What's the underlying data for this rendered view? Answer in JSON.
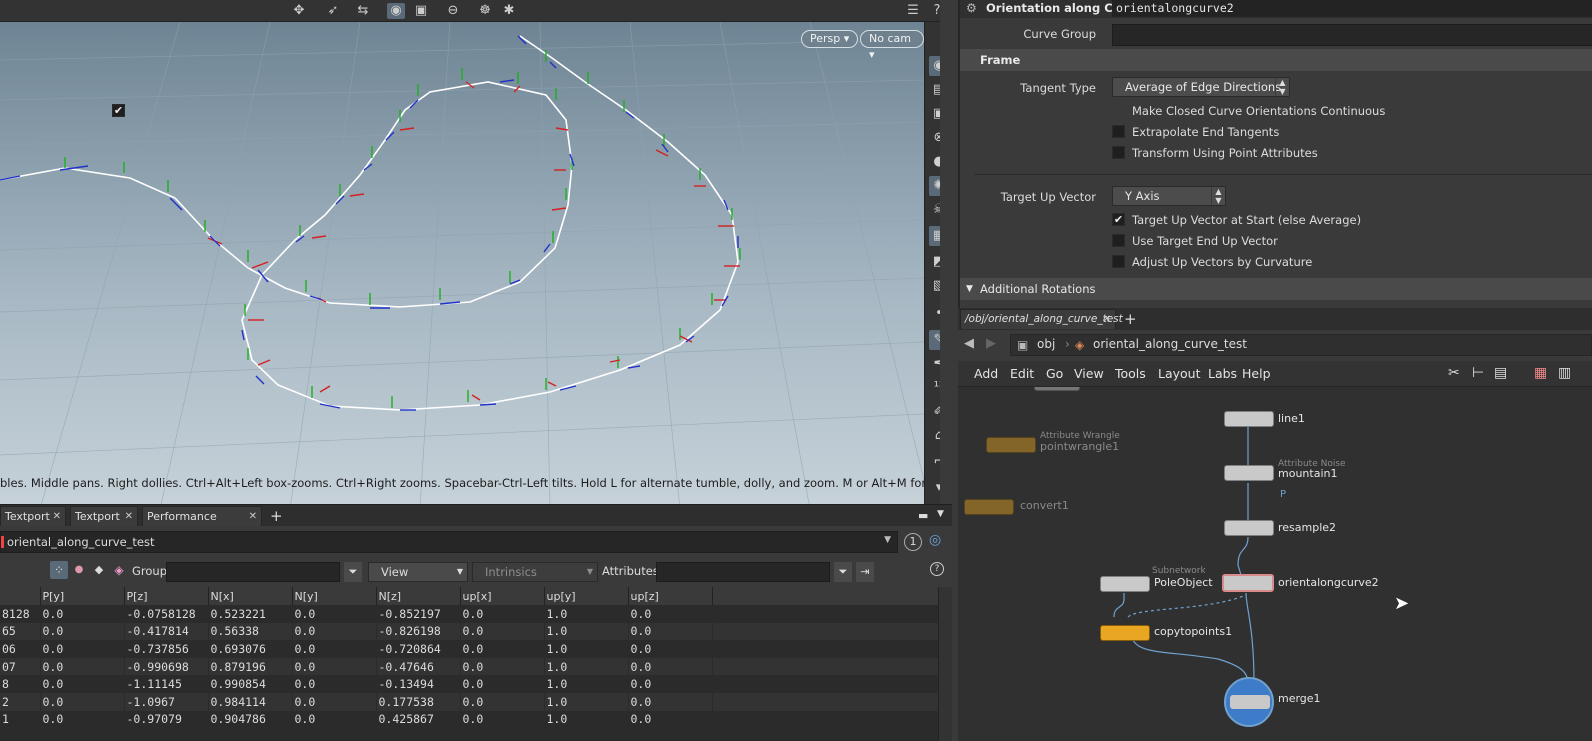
{
  "viewport": {
    "persp_label": "Persp ▾",
    "cam_label": "No cam ▾",
    "status_text": "bles. Middle pans. Right dollies. Ctrl+Alt+Left box-zooms. Ctrl+Right zooms. Spacebar-Ctrl-Left tilts. Hold L for alternate tumble, dolly, and zoom. M or Alt+M for First Person Navigation."
  },
  "pane_tabs": [
    {
      "label": "Textport"
    },
    {
      "label": "Textport"
    },
    {
      "label": "Performance Monitor"
    }
  ],
  "spreadsheet": {
    "node_path": "oriental_along_curve_test",
    "badge": "1",
    "group_label": "Group:",
    "view_label": "View",
    "intrinsics_label": "Intrinsics",
    "attributes_label": "Attributes:",
    "columns": [
      "",
      "P[y]",
      "P[z]",
      "N[x]",
      "N[y]",
      "N[z]",
      "up[x]",
      "up[y]",
      "up[z]"
    ],
    "rows": [
      [
        "8128",
        "0.0",
        "-0.0758128",
        "0.523221",
        "0.0",
        "-0.852197",
        "0.0",
        "1.0",
        "0.0"
      ],
      [
        "65",
        "0.0",
        "-0.417814",
        "0.56338",
        "0.0",
        "-0.826198",
        "0.0",
        "1.0",
        "0.0"
      ],
      [
        "06",
        "0.0",
        "-0.737856",
        "0.693076",
        "0.0",
        "-0.720864",
        "0.0",
        "1.0",
        "0.0"
      ],
      [
        "07",
        "0.0",
        "-0.990698",
        "0.879196",
        "0.0",
        "-0.47646",
        "0.0",
        "1.0",
        "0.0"
      ],
      [
        "8",
        "0.0",
        "-1.11145",
        "0.990854",
        "0.0",
        "-0.13494",
        "0.0",
        "1.0",
        "0.0"
      ],
      [
        "2",
        "0.0",
        "-1.0967",
        "0.984114",
        "0.0",
        "0.177538",
        "0.0",
        "1.0",
        "0.0"
      ],
      [
        "1",
        "0.0",
        "-0.97079",
        "0.904786",
        "0.0",
        "0.425867",
        "0.0",
        "1.0",
        "0.0"
      ]
    ]
  },
  "params": {
    "node_type": "Orientation along Curve",
    "node_name": "orientalongcurve2",
    "curve_group_label": "Curve Group",
    "frame_section": "Frame",
    "tangent_type_label": "Tangent Type",
    "tangent_type_value": "Average of Edge Directions",
    "checks_frame": [
      {
        "label": "Make Closed Curve Orientations Continuous",
        "checked": true
      },
      {
        "label": "Extrapolate End Tangents",
        "checked": false
      },
      {
        "label": "Transform Using Point Attributes",
        "checked": false
      }
    ],
    "target_up_label": "Target Up Vector",
    "target_up_value": "Y Axis",
    "checks_up": [
      {
        "label": "Target Up Vector at Start (else Average)",
        "checked": true
      },
      {
        "label": "Use Target End Up Vector",
        "checked": false
      },
      {
        "label": "Adjust Up Vectors by Curvature",
        "checked": false
      }
    ],
    "additional_section": "Additional Rotations"
  },
  "network": {
    "tab_label": "/obj/oriental_along_curve_test",
    "path_obj": "obj",
    "path_geo": "oriental_along_curve_test",
    "menu": [
      "Add",
      "Edit",
      "Go",
      "View",
      "Tools",
      "Layout",
      "Labs",
      "Help"
    ],
    "nodes": {
      "line1": "line1",
      "mountain_sub": "Attribute Noise",
      "mountain1": "mountain1",
      "mountain_flag": "P",
      "resample2": "resample2",
      "orient": "orientalongcurve2",
      "pole_sub": "Subnetwork",
      "pole": "PoleObject",
      "copy": "copytopoints1",
      "merge": "merge1",
      "wrangle_sub": "Attribute Wrangle",
      "wrangle": "pointwrangle1",
      "convert": "convert1"
    }
  }
}
